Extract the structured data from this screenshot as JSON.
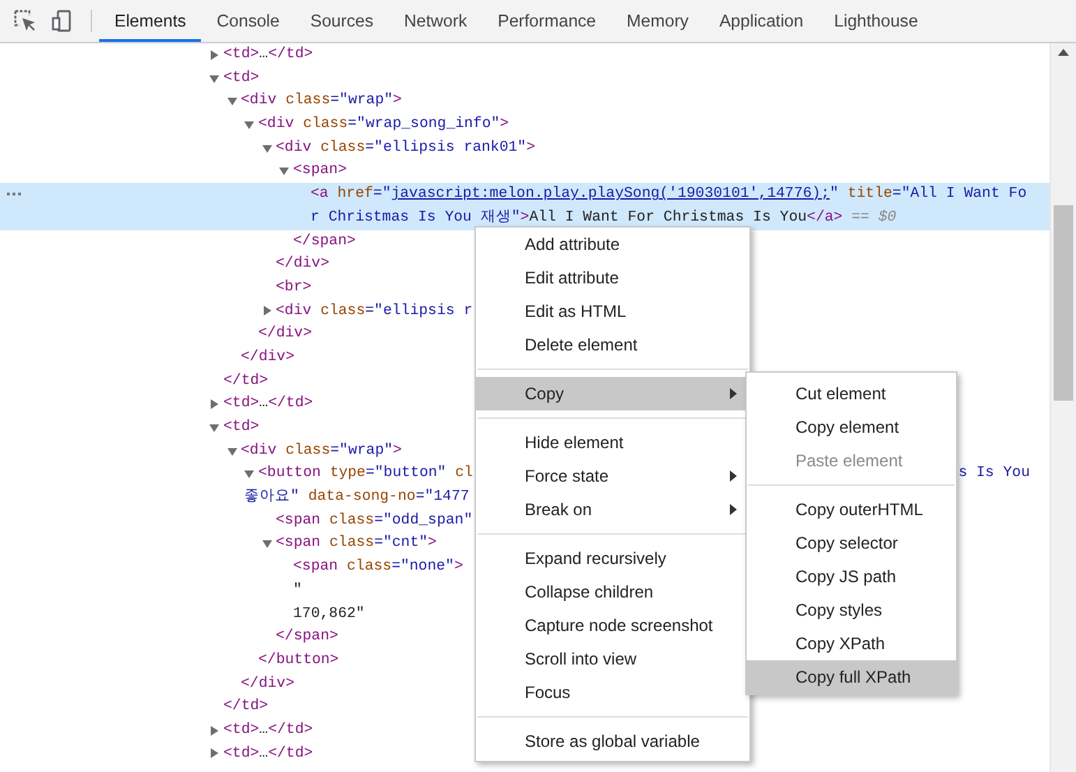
{
  "toolbar": {
    "tabs": [
      {
        "label": "Elements",
        "selected": true
      },
      {
        "label": "Console",
        "selected": false
      },
      {
        "label": "Sources",
        "selected": false
      },
      {
        "label": "Network",
        "selected": false
      },
      {
        "label": "Performance",
        "selected": false
      },
      {
        "label": "Memory",
        "selected": false
      },
      {
        "label": "Application",
        "selected": false
      },
      {
        "label": "Lighthouse",
        "selected": false
      }
    ]
  },
  "dom_tree": {
    "nodes": [
      {
        "selected": false,
        "expanded": false,
        "lines": [
          {
            "tokens": [
              {
                "kind": "tag",
                "text": "<td>"
              },
              {
                "kind": "text",
                "text": "…"
              },
              {
                "kind": "tag",
                "text": "</td>"
              }
            ]
          }
        ]
      },
      {
        "selected": false,
        "expanded": true,
        "lines": [
          {
            "tokens": [
              {
                "kind": "tag",
                "text": "<td>"
              }
            ]
          }
        ],
        "close": [
          {
            "kind": "tag",
            "text": "</td>"
          }
        ],
        "children": [
          {
            "selected": false,
            "expanded": true,
            "lines": [
              {
                "tokens": [
                  {
                    "kind": "tag",
                    "text": "<div"
                  },
                  {
                    "kind": "attr",
                    "text": " class"
                  },
                  {
                    "kind": "value",
                    "text": "=\"wrap\""
                  },
                  {
                    "kind": "tag",
                    "text": ">"
                  }
                ]
              }
            ],
            "close": [
              {
                "kind": "tag",
                "text": "</div>"
              }
            ],
            "children": [
              {
                "selected": false,
                "expanded": true,
                "lines": [
                  {
                    "tokens": [
                      {
                        "kind": "tag",
                        "text": "<div"
                      },
                      {
                        "kind": "attr",
                        "text": " class"
                      },
                      {
                        "kind": "value",
                        "text": "=\"wrap_song_info\""
                      },
                      {
                        "kind": "tag",
                        "text": ">"
                      }
                    ]
                  }
                ],
                "close": [
                  {
                    "kind": "tag",
                    "text": "</div>"
                  }
                ],
                "children": [
                  {
                    "selected": false,
                    "expanded": true,
                    "lines": [
                      {
                        "tokens": [
                          {
                            "kind": "tag",
                            "text": "<div"
                          },
                          {
                            "kind": "attr",
                            "text": " class"
                          },
                          {
                            "kind": "value",
                            "text": "=\"ellipsis rank01\""
                          },
                          {
                            "kind": "tag",
                            "text": ">"
                          }
                        ]
                      }
                    ],
                    "close": [
                      {
                        "kind": "tag",
                        "text": "</div>"
                      }
                    ],
                    "children": [
                      {
                        "selected": false,
                        "expanded": true,
                        "lines": [
                          {
                            "tokens": [
                              {
                                "kind": "tag",
                                "text": "<span>"
                              }
                            ]
                          }
                        ],
                        "close": [
                          {
                            "kind": "tag",
                            "text": "</span>"
                          }
                        ],
                        "children": [
                          {
                            "selected": true,
                            "lines": [
                              {
                                "tokens": [
                                  {
                                    "kind": "tag",
                                    "text": "<a"
                                  },
                                  {
                                    "kind": "attr",
                                    "text": " href"
                                  },
                                  {
                                    "kind": "value",
                                    "text": "=\""
                                  },
                                  {
                                    "kind": "link",
                                    "text": "javascript:melon.play.playSong('19030101',14776);"
                                  },
                                  {
                                    "kind": "value",
                                    "text": "\""
                                  },
                                  {
                                    "kind": "attr",
                                    "text": " title"
                                  },
                                  {
                                    "kind": "value",
                                    "text": "=\"All I Want Fo"
                                  }
                                ]
                              },
                              {
                                "tokens": [
                                  {
                                    "kind": "value",
                                    "text": "r Christmas Is You 재생\""
                                  },
                                  {
                                    "kind": "tag",
                                    "text": ">"
                                  },
                                  {
                                    "kind": "text",
                                    "text": "All I Want For Christmas Is You"
                                  },
                                  {
                                    "kind": "tag",
                                    "text": "</a>"
                                  },
                                  {
                                    "kind": "note",
                                    "text": " == $0"
                                  }
                                ]
                              }
                            ]
                          }
                        ]
                      }
                    ]
                  },
                  {
                    "selected": false,
                    "lines": [
                      {
                        "tokens": [
                          {
                            "kind": "tag",
                            "text": "<br>"
                          }
                        ]
                      }
                    ]
                  },
                  {
                    "selected": false,
                    "expanded": false,
                    "lines": [
                      {
                        "tokens": [
                          {
                            "kind": "tag",
                            "text": "<div"
                          },
                          {
                            "kind": "attr",
                            "text": " class"
                          },
                          {
                            "kind": "value",
                            "text": "=\"ellipsis r"
                          }
                        ]
                      }
                    ]
                  }
                ]
              }
            ]
          }
        ]
      },
      {
        "selected": false,
        "expanded": false,
        "lines": [
          {
            "tokens": [
              {
                "kind": "tag",
                "text": "<td>"
              },
              {
                "kind": "text",
                "text": "…"
              },
              {
                "kind": "tag",
                "text": "</td>"
              }
            ]
          }
        ]
      },
      {
        "selected": false,
        "expanded": true,
        "lines": [
          {
            "tokens": [
              {
                "kind": "tag",
                "text": "<td>"
              }
            ]
          }
        ],
        "close": [
          {
            "kind": "tag",
            "text": "</td>"
          }
        ],
        "children": [
          {
            "selected": false,
            "expanded": true,
            "lines": [
              {
                "tokens": [
                  {
                    "kind": "tag",
                    "text": "<div"
                  },
                  {
                    "kind": "attr",
                    "text": " class"
                  },
                  {
                    "kind": "value",
                    "text": "=\"wrap\""
                  },
                  {
                    "kind": "tag",
                    "text": ">"
                  }
                ]
              }
            ],
            "close": [
              {
                "kind": "tag",
                "text": "</div>"
              }
            ],
            "children": [
              {
                "selected": false,
                "expanded": true,
                "lines": [
                  {
                    "tokens": [
                      {
                        "kind": "tag",
                        "text": "<button"
                      },
                      {
                        "kind": "attr",
                        "text": " type"
                      },
                      {
                        "kind": "value",
                        "text": "=\"button\""
                      },
                      {
                        "kind": "attr",
                        "text": " cl"
                      }
                    ],
                    "tail": [
                      {
                        "kind": "value",
                        "text": "s Is You"
                      }
                    ]
                  },
                  {
                    "tokens": [
                      {
                        "kind": "value",
                        "text": "좋아요\""
                      },
                      {
                        "kind": "attr",
                        "text": " data-song-no"
                      },
                      {
                        "kind": "value",
                        "text": "=\"1477"
                      }
                    ]
                  }
                ],
                "close": [
                  {
                    "kind": "tag",
                    "text": "</button>"
                  }
                ],
                "children": [
                  {
                    "selected": false,
                    "lines": [
                      {
                        "tokens": [
                          {
                            "kind": "tag",
                            "text": "<span"
                          },
                          {
                            "kind": "attr",
                            "text": " class"
                          },
                          {
                            "kind": "value",
                            "text": "=\"odd_span\""
                          }
                        ]
                      }
                    ]
                  },
                  {
                    "selected": false,
                    "expanded": true,
                    "lines": [
                      {
                        "tokens": [
                          {
                            "kind": "tag",
                            "text": "<span"
                          },
                          {
                            "kind": "attr",
                            "text": " class"
                          },
                          {
                            "kind": "value",
                            "text": "=\"cnt\""
                          },
                          {
                            "kind": "tag",
                            "text": ">"
                          }
                        ]
                      }
                    ],
                    "close": [
                      {
                        "kind": "tag",
                        "text": "</span>"
                      }
                    ],
                    "children": [
                      {
                        "selected": false,
                        "lines": [
                          {
                            "tokens": [
                              {
                                "kind": "tag",
                                "text": "<span"
                              },
                              {
                                "kind": "attr",
                                "text": " class"
                              },
                              {
                                "kind": "value",
                                "text": "=\"none\""
                              },
                              {
                                "kind": "tag",
                                "text": ">"
                              }
                            ]
                          }
                        ]
                      },
                      {
                        "selected": false,
                        "lines": [
                          {
                            "tokens": [
                              {
                                "kind": "text",
                                "text": "\""
                              }
                            ]
                          },
                          {
                            "tokens": [
                              {
                                "kind": "text",
                                "text": "170,862\""
                              }
                            ]
                          }
                        ]
                      }
                    ]
                  }
                ]
              }
            ]
          }
        ]
      },
      {
        "selected": false,
        "expanded": false,
        "lines": [
          {
            "tokens": [
              {
                "kind": "tag",
                "text": "<td>"
              },
              {
                "kind": "text",
                "text": "…"
              },
              {
                "kind": "tag",
                "text": "</td>"
              }
            ]
          }
        ]
      },
      {
        "selected": false,
        "expanded": false,
        "lines": [
          {
            "tokens": [
              {
                "kind": "tag",
                "text": "<td>"
              },
              {
                "kind": "text",
                "text": "…"
              },
              {
                "kind": "tag",
                "text": "</td>"
              }
            ]
          }
        ]
      }
    ]
  },
  "context_menu": {
    "items": [
      {
        "kind": "item",
        "label": "Add attribute",
        "selected": false,
        "disabled": false,
        "submenu": false
      },
      {
        "kind": "item",
        "label": "Edit attribute",
        "selected": false,
        "disabled": false,
        "submenu": false
      },
      {
        "kind": "item",
        "label": "Edit as HTML",
        "selected": false,
        "disabled": false,
        "submenu": false
      },
      {
        "kind": "item",
        "label": "Delete element",
        "selected": false,
        "disabled": false,
        "submenu": false
      },
      {
        "kind": "separator"
      },
      {
        "kind": "item",
        "label": "Copy",
        "selected": true,
        "disabled": false,
        "submenu": true
      },
      {
        "kind": "separator"
      },
      {
        "kind": "item",
        "label": "Hide element",
        "selected": false,
        "disabled": false,
        "submenu": false
      },
      {
        "kind": "item",
        "label": "Force state",
        "selected": false,
        "disabled": false,
        "submenu": true
      },
      {
        "kind": "item",
        "label": "Break on",
        "selected": false,
        "disabled": false,
        "submenu": true
      },
      {
        "kind": "separator"
      },
      {
        "kind": "item",
        "label": "Expand recursively",
        "selected": false,
        "disabled": false,
        "submenu": false
      },
      {
        "kind": "item",
        "label": "Collapse children",
        "selected": false,
        "disabled": false,
        "submenu": false
      },
      {
        "kind": "item",
        "label": "Capture node screenshot",
        "selected": false,
        "disabled": false,
        "submenu": false
      },
      {
        "kind": "item",
        "label": "Scroll into view",
        "selected": false,
        "disabled": false,
        "submenu": false
      },
      {
        "kind": "item",
        "label": "Focus",
        "selected": false,
        "disabled": false,
        "submenu": false
      },
      {
        "kind": "separator"
      },
      {
        "kind": "item",
        "label": "Store as global variable",
        "selected": false,
        "disabled": false,
        "submenu": false
      }
    ]
  },
  "copy_submenu": {
    "items": [
      {
        "kind": "item",
        "label": "Cut element",
        "selected": false,
        "disabled": false
      },
      {
        "kind": "item",
        "label": "Copy element",
        "selected": false,
        "disabled": false
      },
      {
        "kind": "item",
        "label": "Paste element",
        "selected": false,
        "disabled": true
      },
      {
        "kind": "separator"
      },
      {
        "kind": "item",
        "label": "Copy outerHTML",
        "selected": false,
        "disabled": false
      },
      {
        "kind": "item",
        "label": "Copy selector",
        "selected": false,
        "disabled": false
      },
      {
        "kind": "item",
        "label": "Copy JS path",
        "selected": false,
        "disabled": false
      },
      {
        "kind": "item",
        "label": "Copy styles",
        "selected": false,
        "disabled": false
      },
      {
        "kind": "item",
        "label": "Copy XPath",
        "selected": false,
        "disabled": false
      },
      {
        "kind": "item",
        "label": "Copy full XPath",
        "selected": true,
        "disabled": false
      }
    ]
  }
}
